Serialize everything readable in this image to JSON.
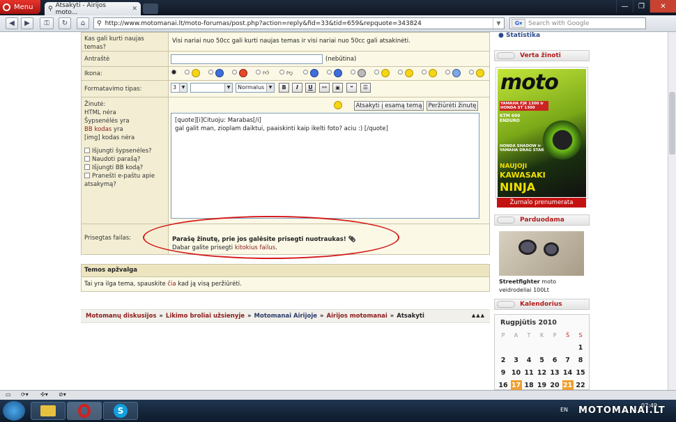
{
  "browser": {
    "menu_label": "Menu",
    "tab_title": "Atsakyti - Airijos moto...",
    "url": "http://www.motomanai.lt/moto-forumas/post.php?action=reply&fid=33&tid=659&repquote=343824",
    "search_placeholder": "Search with Google"
  },
  "form": {
    "rows": {
      "who_can_post_label": "Kas gali kurti naujas temas?",
      "who_can_post_value": "Visi nariai nuo 50cc gali kurti naujas temas ir visi nariai nuo 50cc gali atsakinėti.",
      "subject_label": "Antraštė",
      "subject_value": "",
      "subject_note": "(nebūtina)",
      "icon_label": "Ikona:",
      "format_label": "Formatavimo tipas:",
      "font_size": "3",
      "font_face": "",
      "font_style": "Normalus",
      "toolbar_bold": "B",
      "toolbar_italic": "I",
      "toolbar_underline": "U"
    },
    "message": {
      "label_line1": "Žinutė:",
      "label_line2": "HTML nėra",
      "label_line3": "Šypsenėlės yra",
      "label_bbcode_link": "BB kodas",
      "label_bbcode_suffix": " yra",
      "label_img": "[img] kodas nėra",
      "option_disable_smilies": "Išjungti šypsenėles?",
      "option_use_signature": "Naudoti parašą?",
      "option_disable_bbcode": "Išjungti BB kodą?",
      "option_email_notify": "Pranešti e-paštu apie atsakymą?",
      "quote_button": "Atsakyti į esamą temą",
      "preview_button": "Peržiūrėti žinutę",
      "body_line1": "[quote][i]Cituoju:  Marabas[/i]",
      "body_line2": "gal galit man, zioplam daiktui, paaiskinti kaip ikelti foto? aciu :) [/quote]"
    },
    "attachment": {
      "label": "Prisegtas failas:",
      "notice_bold": "Parašę žinutę, prie jos galėsite prisegti nuotraukas!",
      "notice_prefix": "Dabar galite prisegti ",
      "notice_link": "kitokius failus",
      "notice_suffix": "."
    }
  },
  "topic_review": {
    "header": "Temos apžvalga",
    "text_prefix": "Tai yra ilga tema, spauskite ",
    "text_link": "čia",
    "text_suffix": " kad ją visą peržiūrėti."
  },
  "breadcrumb": {
    "items": [
      "Motomanų diskusijos",
      "Likimo broliai užsienyje",
      "Motomanai Airijoje",
      "Airijos motomanai"
    ],
    "separator": "»",
    "current": "Atsakyti",
    "arrows": "▲▲▲"
  },
  "sidebar": {
    "statistika": "Statistika",
    "verta_zinoti": "Verta žinoti",
    "magazine_title": "moto",
    "magazine_cover_lines": [
      "YAMAHA FJR 1300 ir HONDA ST 1300",
      "KTM 690 ENDURO",
      "HONDA SHADOW ir YAMAHA DRAG STAR",
      "NAUJOJI",
      "KAWASAKI",
      "NINJA"
    ],
    "subscribe_button": "Žurnalo prenumerata",
    "parduodama": "Parduodama",
    "item_title": "Streetfighter",
    "item_desc": " moto veidrodeliai 100Lt",
    "kalendorius": "Kalendorius",
    "calendar_month": "Rugpjūtis 2010",
    "calendar_days": [
      "P",
      "A",
      "T",
      "K",
      "P",
      "Š",
      "S"
    ],
    "calendar_weeks": [
      [
        "",
        "",
        "",
        "",
        "",
        "",
        "1"
      ],
      [
        "2",
        "3",
        "4",
        "5",
        "6",
        "7",
        "8"
      ],
      [
        "9",
        "10",
        "11",
        "12",
        "13",
        "14",
        "15"
      ],
      [
        "16",
        "17",
        "18",
        "19",
        "20",
        "21",
        "22"
      ]
    ]
  },
  "taskbar": {
    "lang": "EN",
    "clock": "07:49",
    "watermark": "MOTOMANAI.LT"
  }
}
